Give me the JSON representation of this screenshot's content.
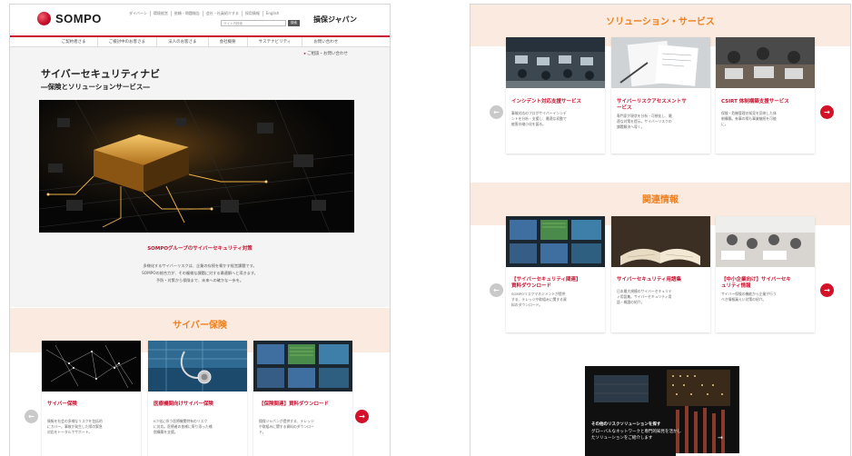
{
  "left": {
    "logo": "SOMPO",
    "util_links": [
      "ダイバーシ",
      "環境経営",
      "依頼・問題報告",
      "会社・社員紹介する",
      "採用情報",
      "English"
    ],
    "search_placeholder": "サイト内検索",
    "search_button": "検索",
    "brand": "損保ジャパン",
    "nav": [
      "ご契約者さま",
      "ご検討中のお客さま",
      "法人のお客さま",
      "会社概要",
      "サステナビリティ",
      "お問い合わせ"
    ],
    "contact_link": "ご相談・お問い合わせ",
    "title": "サイバーセキュリティナビ",
    "subtitle": "―保険とソリューションサービス―",
    "intro_title": "SOMPOグループのサイバーセキュリティ対策",
    "intro_lines": [
      "多様化するサイバーリスクは、企業の存続を脅かす経営課題です。",
      "SOMPOの総合力が、その複雑な課題に対する最適解へと導きます。",
      "予防・対策から保険まで、未来への確かな一歩を。"
    ],
    "section_title": "サイバー保険",
    "cards": [
      {
        "title": "サイバー保険",
        "desc": [
          "情報を社会の多様なリスクを包括的",
          "にカバー。事故が発生した際の緊急",
          "対応をトータルでサポート。"
        ]
      },
      {
        "title": "医療機関向けサイバー保険",
        "desc": [
          "ICT化に伴う医療機関特有のリスク",
          "に対応。医療者の皆様に寄り添った補",
          "償構築を支援。"
        ]
      },
      {
        "title": "【保険関連】資料ダウンロード",
        "desc": [
          "損保ジャパンが提供する、テレッジ",
          "や取組みに関する資料のダウンロー",
          "ド。"
        ]
      }
    ],
    "prev": "←",
    "next": "→"
  },
  "right": {
    "section1_title": "ソリューション・サービス",
    "cards1": [
      {
        "title": [
          "インシデント対応支援サービス"
        ],
        "desc": [
          "事故対応のプロがサイバーインシデ",
          "ントを分析・支援し、最適な初動で",
          "被害の縮小化を図る。"
        ]
      },
      {
        "title": [
          "サイバーリスクアセスメントサ",
          "ービス"
        ],
        "desc": [
          "専門家が現状を分析・可視化し、最",
          "適な対策を提示。サイバーリスクの",
          "課題解決へ導く。"
        ]
      },
      {
        "title": [
          "CSIRT 体制構築支援サービス"
        ],
        "desc": [
          "保険・危機管理の知見を反映した体",
          "制構築。有事の際も事業継続を可能",
          "に。"
        ]
      }
    ],
    "section2_title": "関連情報",
    "cards2": [
      {
        "title": [
          "【サイバーセキュリティ関連】",
          "資料ダウンロード"
        ],
        "desc": [
          "SOMPOリスクマネジメントが提供",
          "する、テレッジや取組みに関する資",
          "料のダウンロード。"
        ]
      },
      {
        "title": [
          "サイバーセキュリティ用語集"
        ],
        "desc": [
          "日本最大規模のサイバーセキュリテ",
          "ィ用語集。サイバーセキュリティ用",
          "語・概論の紹介。"
        ]
      },
      {
        "title": [
          "【中小企業向け】サイバーセキ",
          "ュリティ情報"
        ],
        "desc": [
          "サイバー保険の機能から企業が行う",
          "べき情報漏えい対策の紹介。"
        ]
      }
    ],
    "banner_lines": [
      "その他のリスクソリューションを探す",
      "グローバルなネットワークと専門的知見を活かし",
      "たソリューションをご紹介します"
    ],
    "banner_arrow": "→",
    "prev": "←",
    "next": "→"
  },
  "colors": {
    "brand_red": "#c8102e",
    "accent_orange": "#f07f1c",
    "section_bg": "#fbeadf",
    "page_grey": "#f4f4f4"
  }
}
